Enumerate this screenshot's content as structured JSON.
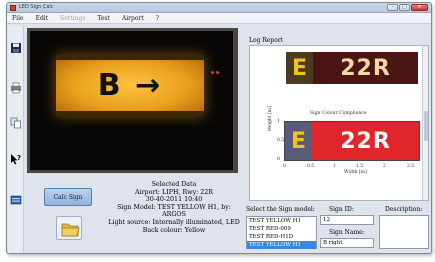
{
  "window": {
    "title": "LED Sign Calc"
  },
  "menu": {
    "items": [
      "File",
      "Edit",
      "Settings",
      "Test",
      "Airport",
      "?"
    ]
  },
  "video": {
    "sign_text": "B →"
  },
  "buttons": {
    "calc_sign": "Calc Sign"
  },
  "selected_data": {
    "heading": "Selected Data",
    "airport": "Airport: LIPH, Rwy: 22R",
    "datetime": "30-40-2011 10:40",
    "sign_model": "Sign Model: TEST YELLOW H1, by:",
    "manufacturer": "ARGOS",
    "light_source": "Light source: Internally illuminated, LED",
    "back_colour": "Back colour: Yellow"
  },
  "log": {
    "title": "Log Report",
    "sign_e": "E",
    "sign_r": "22R",
    "plot_title": "Sign Colour Compliance",
    "ylabel": "Height [m]",
    "xlabel": "Width [m]",
    "yticks": [
      "0",
      "0.5",
      "1"
    ],
    "xticks": [
      "0",
      "0.5",
      "1",
      "1.5",
      "2",
      "2.5"
    ]
  },
  "sign_model": {
    "label": "Select the Sign model:",
    "options": [
      "TEST YELLOW H1",
      "TEST RED-009",
      "TEST RED-H1D",
      "TEST YELLOW H1"
    ],
    "selected_index": 3
  },
  "sign_id": {
    "label": "Sign ID:",
    "value": "12"
  },
  "sign_name": {
    "label": "Sign Name:",
    "value": "B right"
  },
  "description": {
    "label": "Description:",
    "value": ""
  },
  "colors": {
    "accent": "#3a86e0",
    "sign_yellow": "#f4c21b",
    "sign_red": "#e0262a"
  }
}
